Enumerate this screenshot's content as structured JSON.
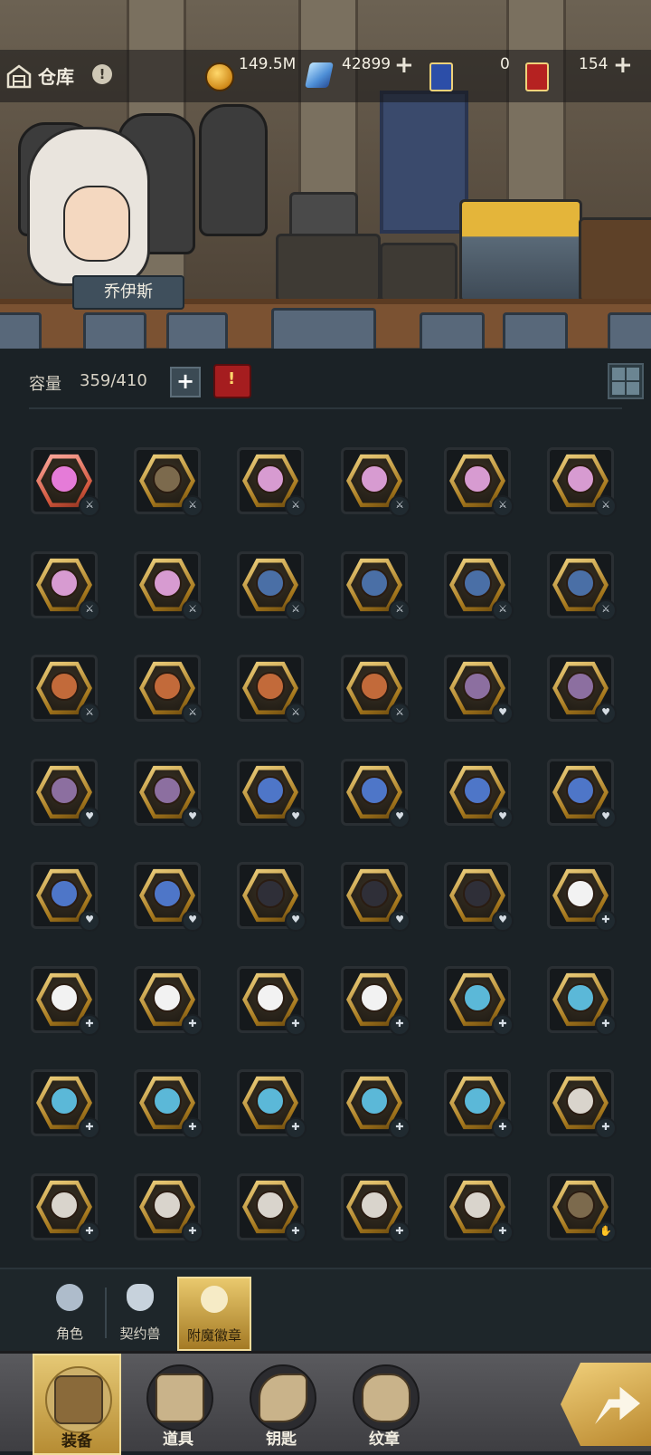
{
  "header": {
    "title": "仓库",
    "info_badge": "!",
    "resources": [
      {
        "name": "gold",
        "value": "149.5M",
        "has_plus": false
      },
      {
        "name": "diamond",
        "value": "42899",
        "has_plus": true
      },
      {
        "name": "blue-ticket",
        "value": "0",
        "has_plus": false
      },
      {
        "name": "red-ticket",
        "value": "154",
        "has_plus": true
      }
    ],
    "plus_label": "+"
  },
  "character": {
    "name": "乔伊斯"
  },
  "capacity": {
    "label": "容量",
    "value": "359/410",
    "plus_label": "+"
  },
  "items": [
    {
      "face": "#e57bd8",
      "badge": "w",
      "frame": "pink"
    },
    {
      "face": "#7c6a4d",
      "badge": "w"
    },
    {
      "face": "#d79bd1",
      "badge": "w"
    },
    {
      "face": "#d79bd1",
      "badge": "w"
    },
    {
      "face": "#d79bd1",
      "badge": "w"
    },
    {
      "face": "#d79bd1",
      "badge": "w"
    },
    {
      "face": "#d79bd1",
      "badge": "w"
    },
    {
      "face": "#d79bd1",
      "badge": "w"
    },
    {
      "face": "#4a6fa6",
      "badge": "w"
    },
    {
      "face": "#4a6fa6",
      "badge": "w"
    },
    {
      "face": "#4a6fa6",
      "badge": "w"
    },
    {
      "face": "#4a6fa6",
      "badge": "w"
    },
    {
      "face": "#c26a3a",
      "badge": "w"
    },
    {
      "face": "#c26a3a",
      "badge": "w"
    },
    {
      "face": "#c26a3a",
      "badge": "w"
    },
    {
      "face": "#c26a3a",
      "badge": "w"
    },
    {
      "face": "#8c6fa0",
      "badge": "v"
    },
    {
      "face": "#8c6fa0",
      "badge": "v"
    },
    {
      "face": "#8c6fa0",
      "badge": "v"
    },
    {
      "face": "#8c6fa0",
      "badge": "v"
    },
    {
      "face": "#4e76c8",
      "badge": "v"
    },
    {
      "face": "#4e76c8",
      "badge": "v"
    },
    {
      "face": "#4e76c8",
      "badge": "v"
    },
    {
      "face": "#4e76c8",
      "badge": "v"
    },
    {
      "face": "#4e76c8",
      "badge": "v"
    },
    {
      "face": "#4e76c8",
      "badge": "v"
    },
    {
      "face": "#2f2f38",
      "badge": "v"
    },
    {
      "face": "#2f2f38",
      "badge": "v"
    },
    {
      "face": "#2f2f38",
      "badge": "v"
    },
    {
      "face": "#f2f2f2",
      "badge": "s"
    },
    {
      "face": "#f2f2f2",
      "badge": "s"
    },
    {
      "face": "#f2f2f2",
      "badge": "s"
    },
    {
      "face": "#f2f2f2",
      "badge": "s"
    },
    {
      "face": "#f2f2f2",
      "badge": "s"
    },
    {
      "face": "#5bb8d8",
      "badge": "s"
    },
    {
      "face": "#5bb8d8",
      "badge": "s"
    },
    {
      "face": "#5bb8d8",
      "badge": "s"
    },
    {
      "face": "#5bb8d8",
      "badge": "s"
    },
    {
      "face": "#5bb8d8",
      "badge": "s"
    },
    {
      "face": "#5bb8d8",
      "badge": "s"
    },
    {
      "face": "#5bb8d8",
      "badge": "s"
    },
    {
      "face": "#d9d4cc",
      "badge": "s"
    },
    {
      "face": "#d9d4cc",
      "badge": "s"
    },
    {
      "face": "#d9d4cc",
      "badge": "s"
    },
    {
      "face": "#d9d4cc",
      "badge": "s"
    },
    {
      "face": "#d9d4cc",
      "badge": "s"
    },
    {
      "face": "#d9d4cc",
      "badge": "s"
    },
    {
      "face": "#7c6a4d",
      "badge": "h"
    }
  ],
  "filters": [
    {
      "label": "角色",
      "active": false
    },
    {
      "label": "契约兽",
      "active": false
    },
    {
      "label": "附魔徽章",
      "active": true
    }
  ],
  "nav": [
    {
      "label": "装备",
      "active": true
    },
    {
      "label": "道具",
      "active": false
    },
    {
      "label": "钥匙",
      "active": false
    },
    {
      "label": "纹章",
      "active": false
    }
  ]
}
